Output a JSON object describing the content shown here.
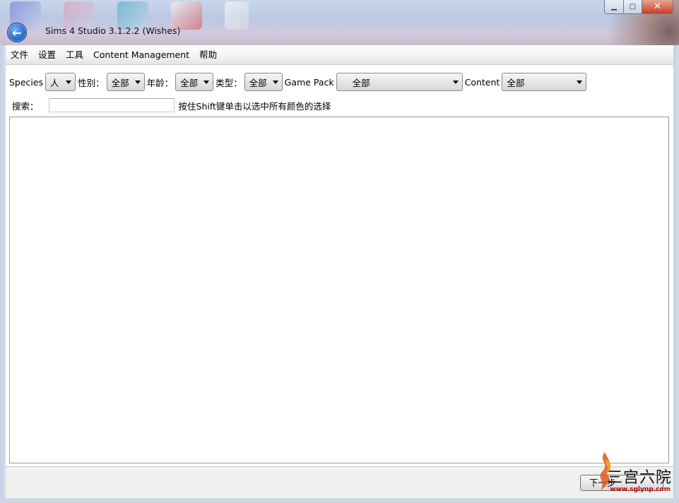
{
  "window": {
    "title": "Sims 4 Studio 3.1.2.2 (Wishes)",
    "controls": {
      "minimize": "▁",
      "maximize": "▢",
      "close": "✕"
    }
  },
  "menu": [
    "文件",
    "设置",
    "工具",
    "Content Management",
    "帮助"
  ],
  "filters": {
    "species": {
      "label": "Species",
      "value": "人"
    },
    "gender": {
      "label": "性别：",
      "value": "全部"
    },
    "age": {
      "label": "年龄：",
      "value": "全部"
    },
    "type": {
      "label": "类型：",
      "value": "全部"
    },
    "game_pack": {
      "label": "Game Pack",
      "value": "全部"
    },
    "content": {
      "label": "Content",
      "value": "全部"
    }
  },
  "search": {
    "label": "搜索：",
    "value": "",
    "hint": "按住Shift键单击以选中所有颜色的选择"
  },
  "footer": {
    "next_label": "下一步"
  },
  "watermark": {
    "text": "三宫六院",
    "url": "www.sglynp.com"
  },
  "icons": {
    "back": "back-arrow-icon",
    "dropdown": "chevron-down-icon"
  },
  "colors": {
    "accent": "#2b6fd0",
    "close": "#c7402a"
  }
}
